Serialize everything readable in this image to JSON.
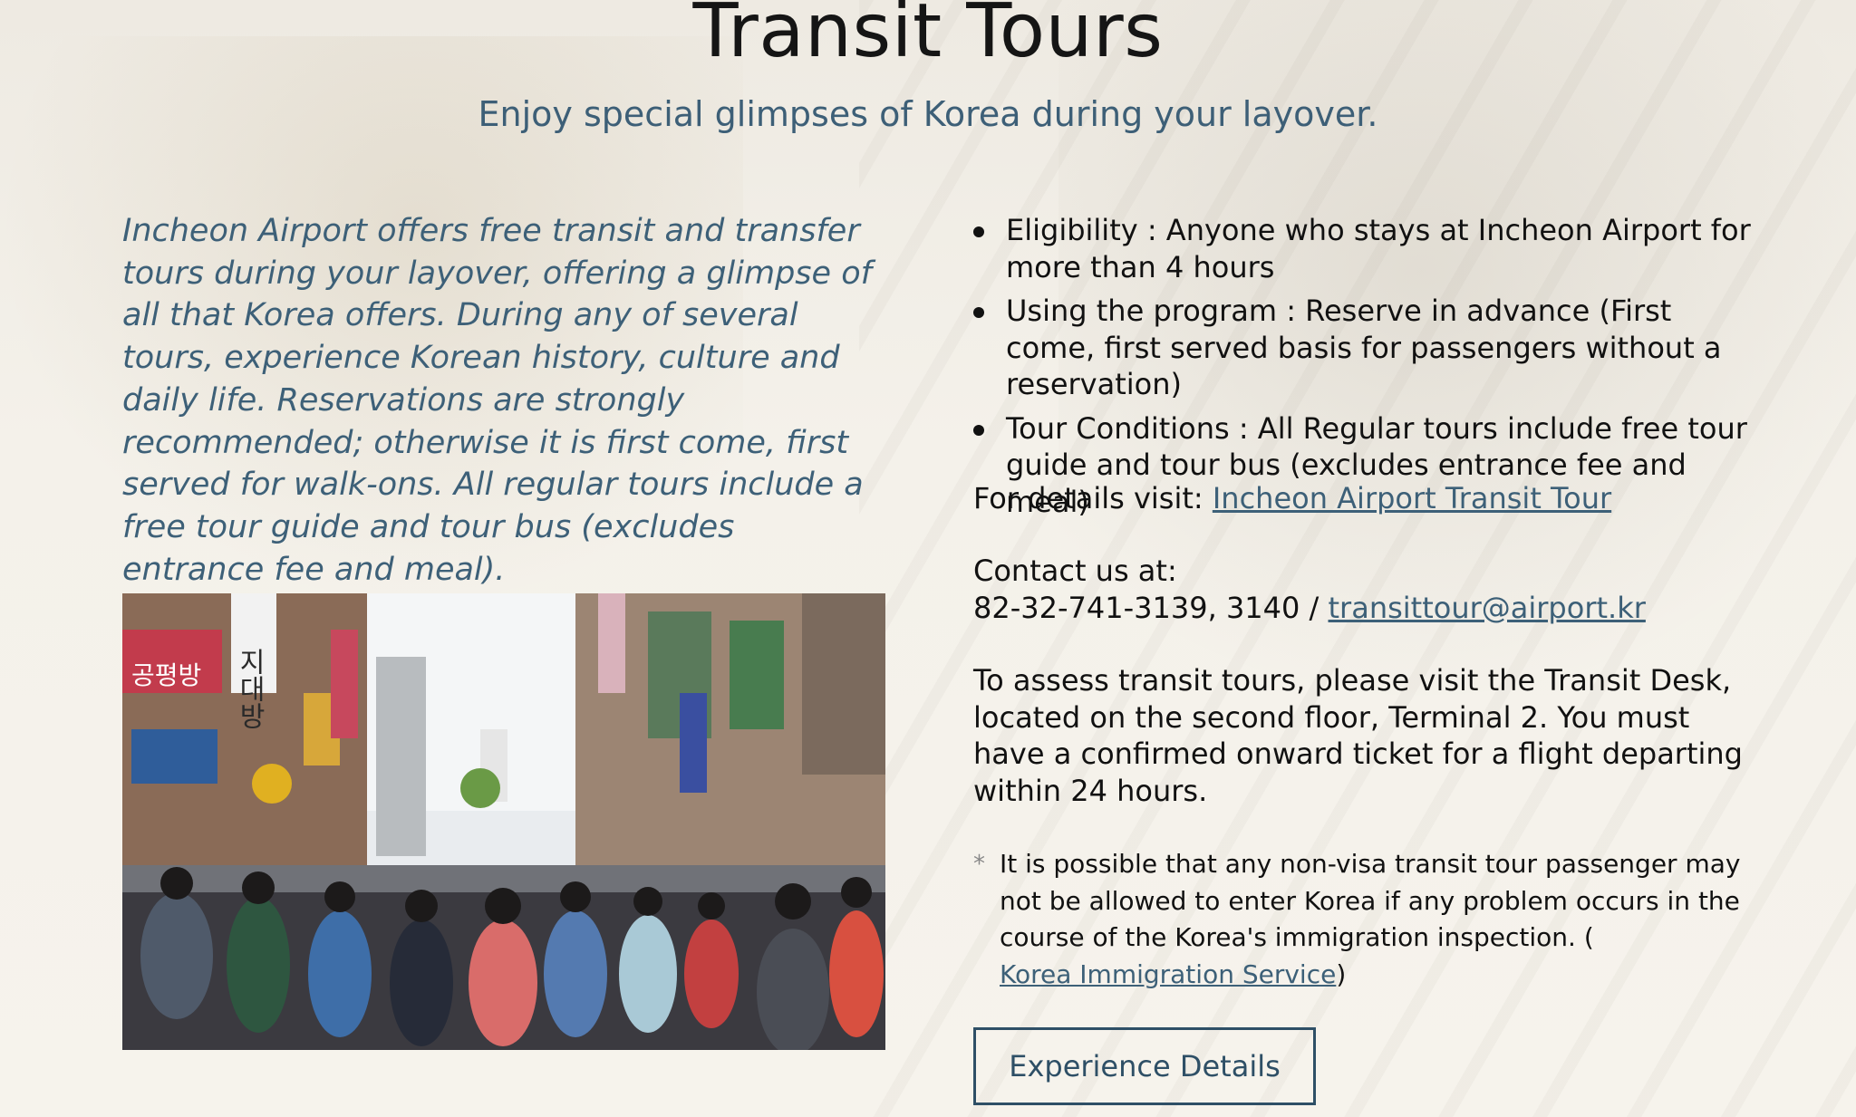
{
  "header": {
    "title": "Transit Tours",
    "subtitle": "Enjoy special glimpses of Korea during your layover."
  },
  "intro": "Incheon Airport offers free transit and transfer tours during your layover, offering a glimpse of all that Korea offers. During any of several tours, experience Korean history, culture and daily life. Reservations are strongly recommended; otherwise it is first come, first served for walk-ons. All regular tours include a free tour guide and tour bus (excludes entrance fee and meal).",
  "bullets": [
    "Eligibility : Anyone who stays at Incheon Airport for more than 4 hours",
    "Using the program : Reserve in advance (First come, first served basis for passengers without a reservation)",
    "Tour Conditions : All Regular tours include free tour guide and tour bus (excludes entrance fee and meal)"
  ],
  "details": {
    "label": "For details visit:",
    "link_text": "Incheon Airport Transit Tour"
  },
  "contact": {
    "label": "Contact us at:",
    "phone": "82-32-741-3139, 3140 /",
    "email": "transittour@airport.kr"
  },
  "assess_text": "To assess transit tours, please visit the Transit Desk, located on the second floor, Terminal 2. You must have a confirmed onward ticket for a flight departing within 24 hours.",
  "note": {
    "star": "*",
    "text": "It is possible that any non-visa transit tour passenger may not be allowed to enter Korea if any problem occurs in the course of the Korea's immigration inspection. (",
    "link_text": "Korea Immigration Service",
    "close": ")"
  },
  "cta_button": "Experience Details",
  "photo_signs": [
    "지대방",
    "공평방"
  ]
}
